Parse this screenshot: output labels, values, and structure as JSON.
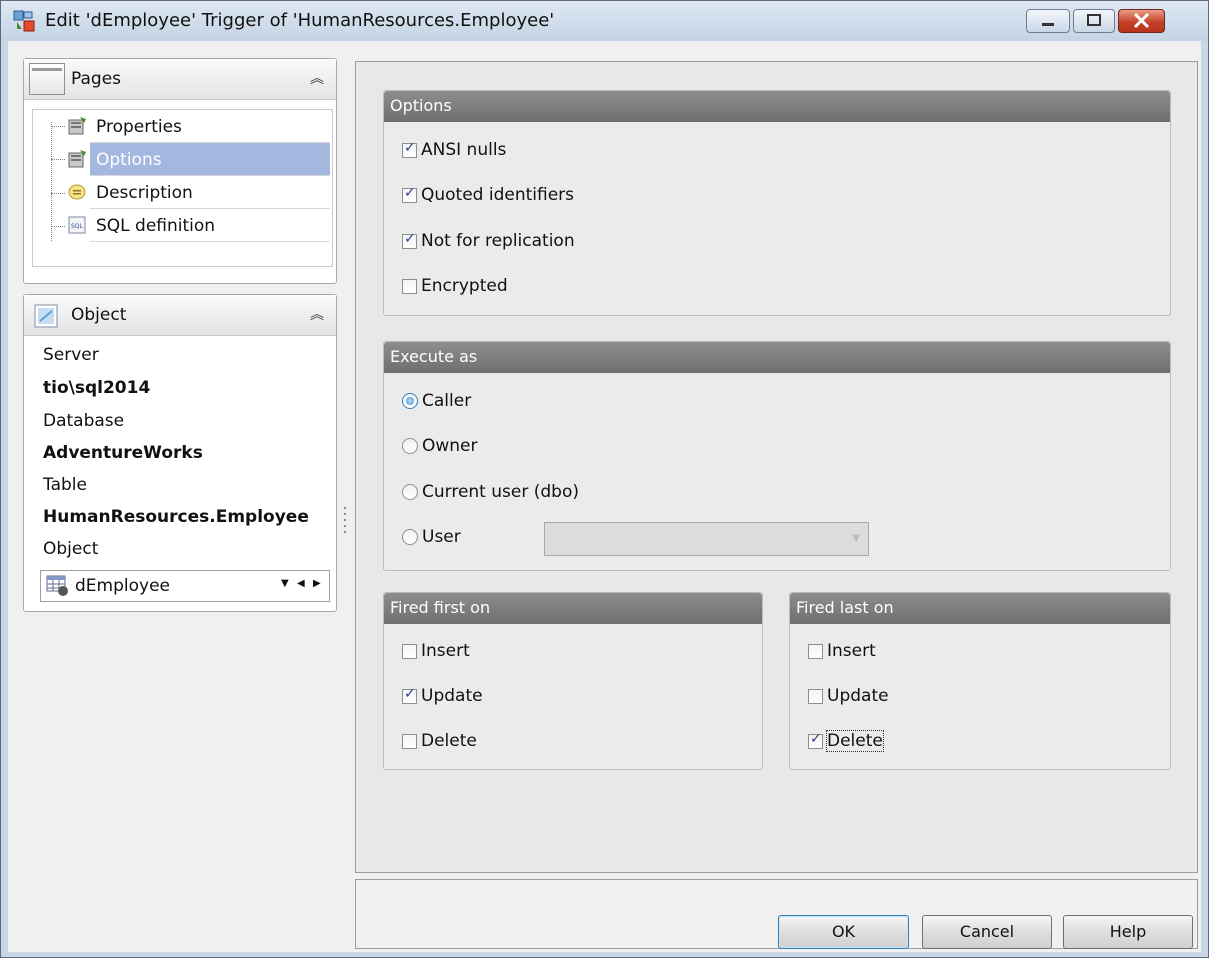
{
  "window": {
    "title": "Edit 'dEmployee' Trigger of 'HumanResources.Employee'",
    "accent_close": "#c5432a"
  },
  "pages_panel": {
    "title": "Pages",
    "items": [
      {
        "label": "Properties"
      },
      {
        "label": "Options",
        "selected": true
      },
      {
        "label": "Description"
      },
      {
        "label": "SQL definition"
      }
    ]
  },
  "object_panel": {
    "title": "Object",
    "server_label": "Server",
    "server_value": "tio\\sql2014",
    "database_label": "Database",
    "database_value": "AdventureWorks",
    "table_label": "Table",
    "table_value": "HumanResources.Employee",
    "object_label": "Object",
    "object_value": "dEmployee"
  },
  "options_group": {
    "title": "Options",
    "items": [
      {
        "label": "ANSI nulls",
        "checked": true
      },
      {
        "label": "Quoted identifiers",
        "checked": true
      },
      {
        "label": "Not for replication",
        "checked": true
      },
      {
        "label": "Encrypted",
        "checked": false
      }
    ]
  },
  "execute_group": {
    "title": "Execute as",
    "items": [
      {
        "label": "Caller",
        "checked": true
      },
      {
        "label": "Owner",
        "checked": false
      },
      {
        "label": "Current user (dbo)",
        "checked": false
      },
      {
        "label": "User",
        "checked": false
      }
    ],
    "user_value": ""
  },
  "fired_first": {
    "title": "Fired first on",
    "items": [
      {
        "label": "Insert",
        "checked": false
      },
      {
        "label": "Update",
        "checked": true
      },
      {
        "label": "Delete",
        "checked": false
      }
    ]
  },
  "fired_last": {
    "title": "Fired last on",
    "items": [
      {
        "label": "Insert",
        "checked": false
      },
      {
        "label": "Update",
        "checked": false
      },
      {
        "label": "Delete",
        "checked": true
      }
    ]
  },
  "buttons": {
    "ok": "OK",
    "cancel": "Cancel",
    "help": "Help"
  }
}
